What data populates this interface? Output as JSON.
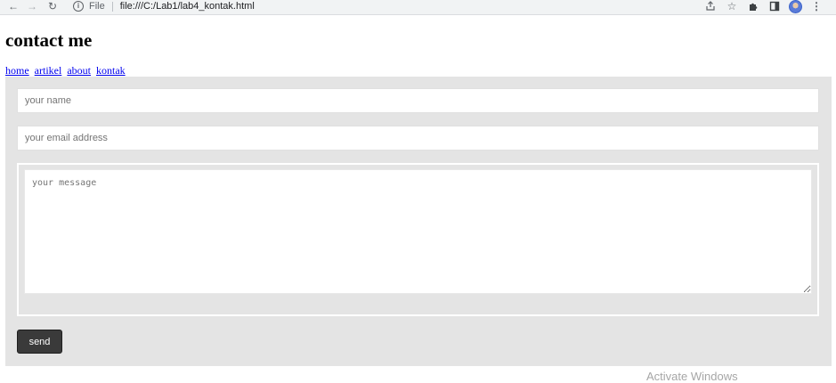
{
  "browser": {
    "scheme_label": "File",
    "url": "file:///C:/Lab1/lab4_kontak.html",
    "info_icon": "info-icon",
    "icons": {
      "back": "arrow-left-icon",
      "forward": "arrow-right-icon",
      "reload": "reload-icon",
      "share": "share-icon",
      "bookmark": "star-icon",
      "extensions": "puzzle-icon",
      "side_panel": "side-panel-icon",
      "profile": "avatar-icon",
      "menu": "kebab-menu-icon"
    }
  },
  "page": {
    "title": "contact me",
    "nav": [
      {
        "label": "home"
      },
      {
        "label": "artikel"
      },
      {
        "label": "about"
      },
      {
        "label": "kontak"
      }
    ]
  },
  "form": {
    "name_placeholder": "your name",
    "name_value": "",
    "email_placeholder": "your email address",
    "email_value": "",
    "message_placeholder": "your message",
    "message_value": "",
    "send_label": "send"
  },
  "watermark": {
    "text": "Activate Windows"
  },
  "colors": {
    "panel_bg": "#e4e4e4",
    "button_bg": "#3a3a3a",
    "link": "#0000ee"
  }
}
